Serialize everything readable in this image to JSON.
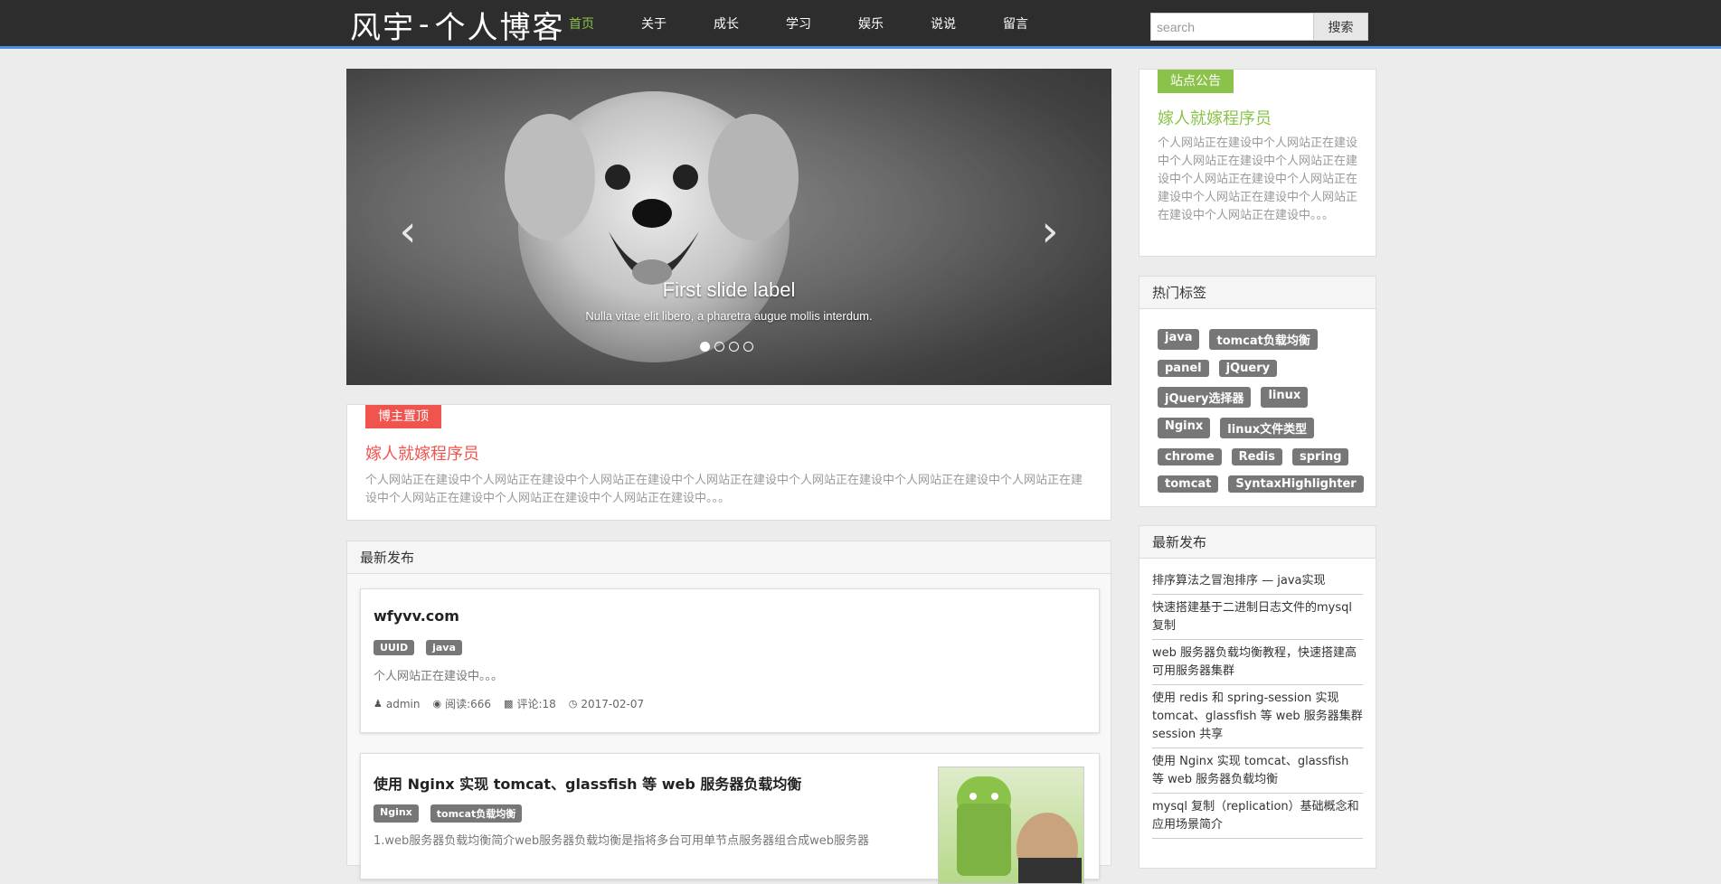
{
  "nav": {
    "brand_main": "风宇",
    "brand_sep": "-",
    "brand_sub": "个人博客",
    "items": [
      {
        "label": "首页",
        "active": true
      },
      {
        "label": "关于"
      },
      {
        "label": "成长"
      },
      {
        "label": "学习"
      },
      {
        "label": "娱乐"
      },
      {
        "label": "说说"
      },
      {
        "label": "留言"
      }
    ],
    "search_placeholder": "search",
    "search_button": "搜索"
  },
  "carousel": {
    "caption_title": "First slide label",
    "caption_text": "Nulla vitae elit libero, a pharetra augue mollis interdum.",
    "prev_icon": "chevron-left",
    "next_icon": "chevron-right",
    "active_slide": 1,
    "slides": 4
  },
  "pinned": {
    "ribbon": "博主置顶",
    "title": "嫁人就嫁程序员",
    "text": "个人网站正在建设中个人网站正在建设中个人网站正在建设中个人网站正在建设中个人网站正在建设中个人网站正在建设中个人网站正在建设中个人网站正在建设中个人网站正在建设中个人网站正在建设中。。。"
  },
  "latest": {
    "heading": "最新发布",
    "posts": [
      {
        "title": "wfyvv.com",
        "tags": [
          "UUID",
          "java"
        ],
        "excerpt": "个人网站正在建设中。。。",
        "author": "admin",
        "views": "阅读:666",
        "comments": "评论:18",
        "date": "2017-02-07"
      },
      {
        "title": "使用 Nginx 实现 tomcat、glassfish 等 web 服务器负载均衡",
        "tags": [
          "Nginx",
          "tomcat负载均衡"
        ],
        "excerpt": "1.web服务器负载均衡简介web服务器负载均衡是指将多台可用单节点服务器组合成web服务器"
      }
    ]
  },
  "notice": {
    "ribbon": "站点公告",
    "title": "嫁人就嫁程序员",
    "text": "个人网站正在建设中个人网站正在建设中个人网站正在建设中个人网站正在建设中个人网站正在建设中个人网站正在建设中个人网站正在建设中个人网站正在建设中个人网站正在建设中。。。"
  },
  "hot_tags": {
    "heading": "热门标签",
    "tags": [
      "java",
      "tomcat负载均衡",
      "panel",
      "jQuery",
      "jQuery选择器",
      "linux",
      "Nginx",
      "linux文件类型",
      "chrome",
      "Redis",
      "spring",
      "tomcat",
      "SyntaxHighlighter"
    ]
  },
  "recent": {
    "heading": "最新发布",
    "items": [
      "排序算法之冒泡排序 — java实现",
      "快速搭建基于二进制日志文件的mysql 复制",
      "web 服务器负载均衡教程，快速搭建高可用服务器集群",
      "使用 redis 和 spring-session 实现 tomcat、glassfish 等 web 服务器集群 session 共享",
      "使用 Nginx 实现 tomcat、glassfish 等 web 服务器负载均衡",
      "mysql 复制（replication）基础概念和应用场景简介"
    ]
  },
  "colors": {
    "navbar_bg": "#2d2d2d",
    "nav_active": "#8bc34a",
    "pinned_accent": "#f0544f",
    "notice_accent": "#8bc34a",
    "tag_bg": "#777777"
  }
}
